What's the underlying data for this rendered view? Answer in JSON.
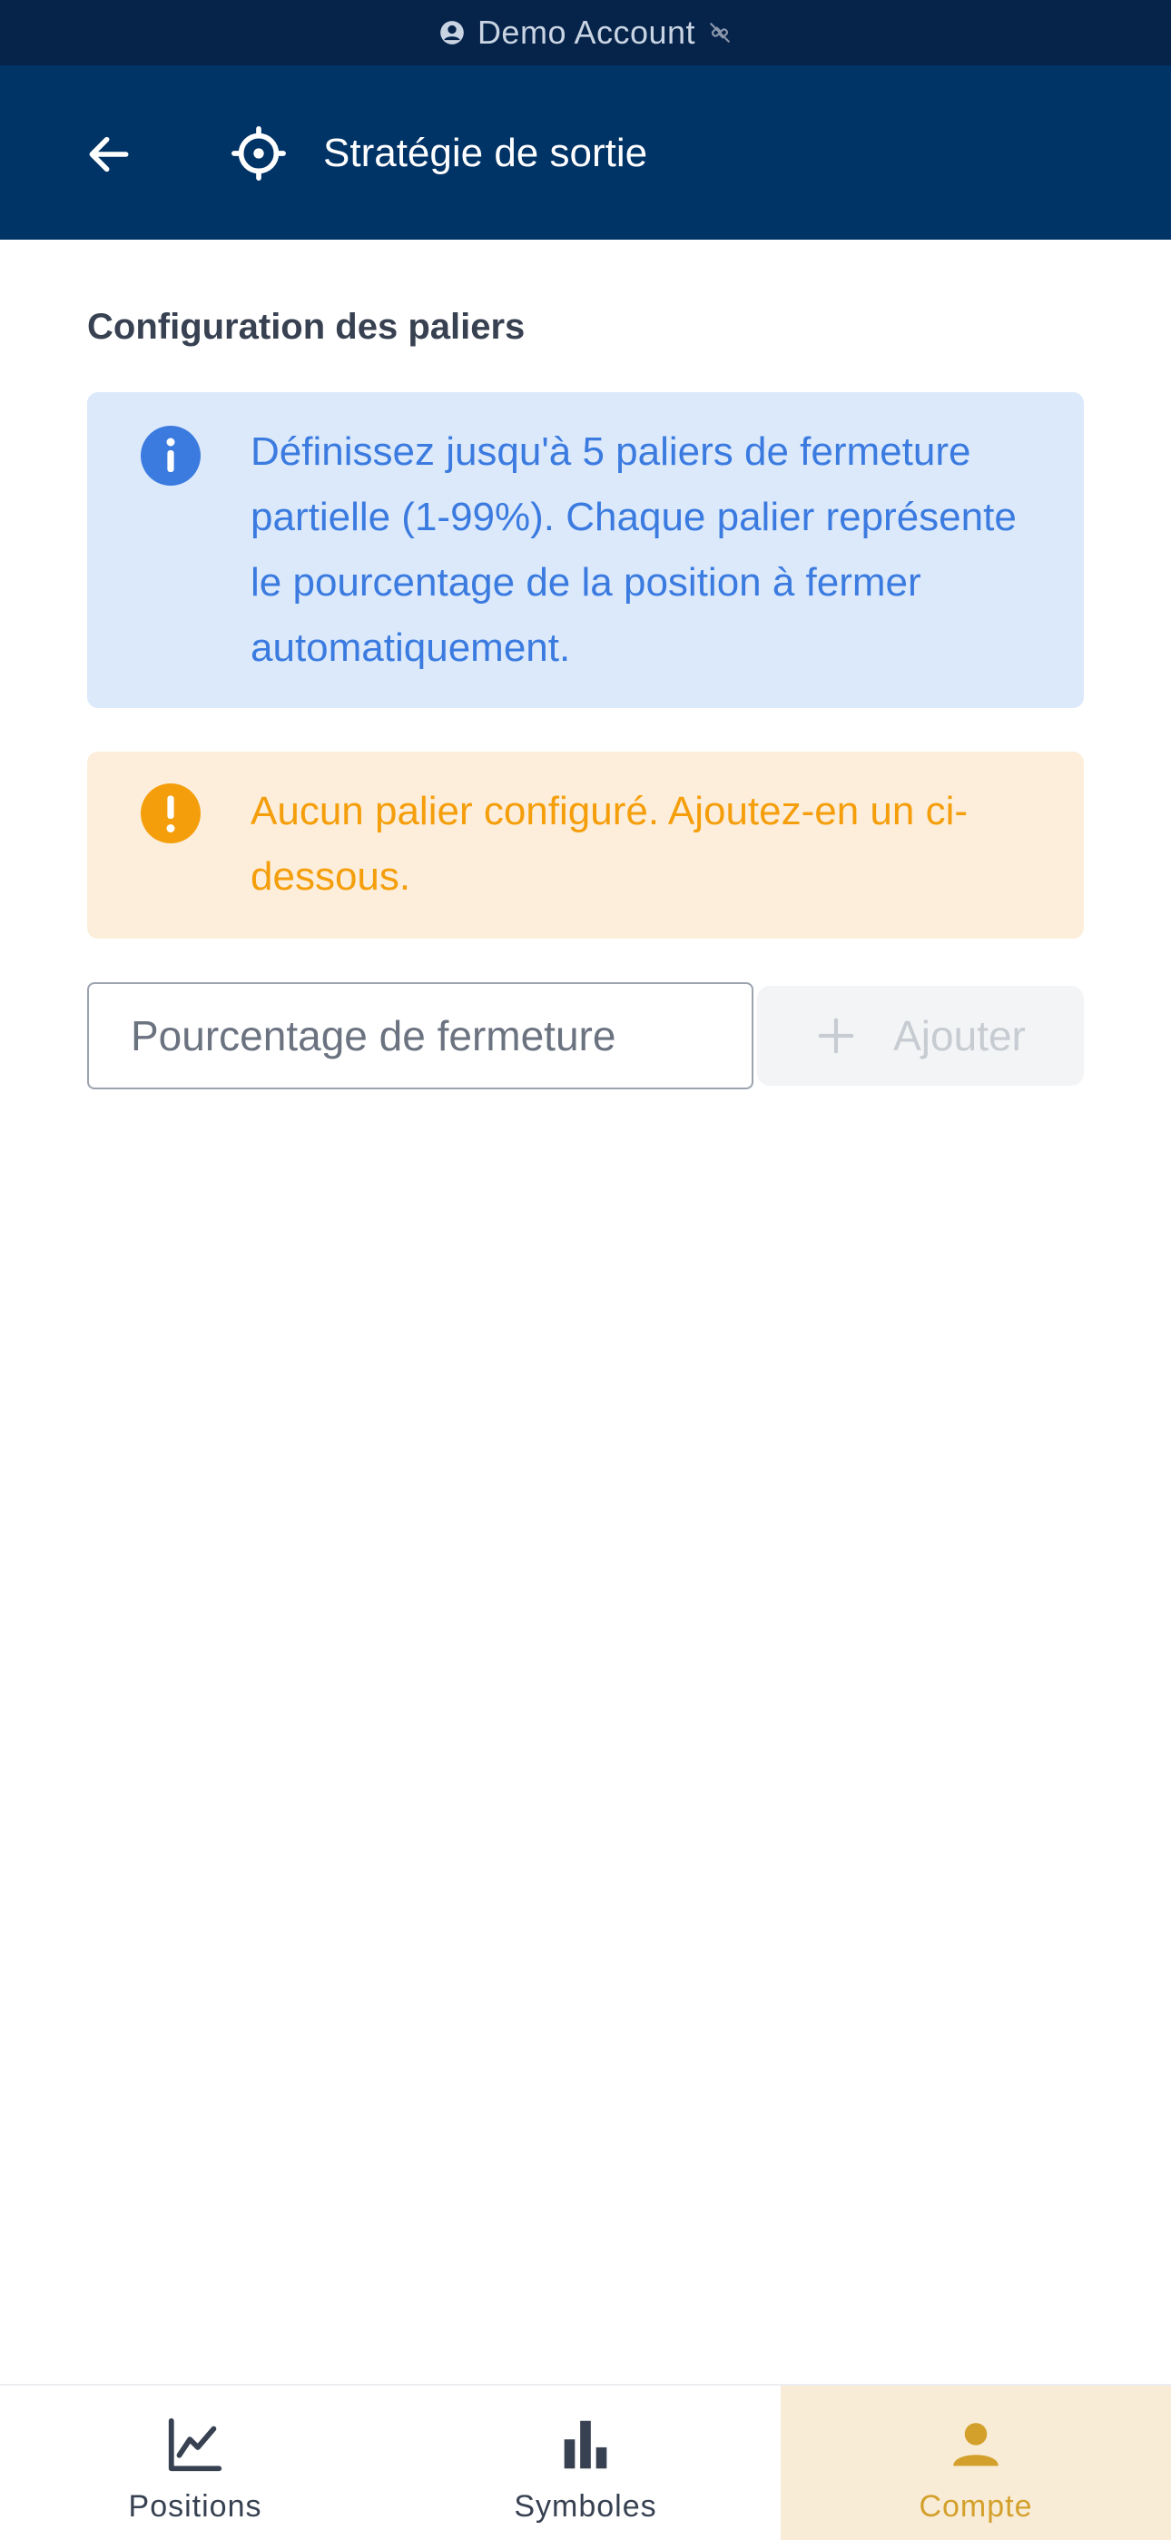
{
  "status_bar": {
    "account_label": "Demo Account",
    "icons": [
      "account-circle-icon",
      "link-off-icon"
    ]
  },
  "app_bar": {
    "title": "Stratégie de sortie",
    "icons": [
      "back-arrow-icon",
      "crosshair-target-icon"
    ]
  },
  "main": {
    "section_title": "Configuration des paliers",
    "info_message": "Définissez jusqu'à 5 paliers de fermeture partielle (1-99%). Chaque palier représente le pourcentage de la position à fermer automatiquement.",
    "warning_message": "Aucun palier configuré. Ajoutez-en un ci-dessous.",
    "percentage_input": {
      "placeholder": "Pourcentage de fermeture",
      "value": ""
    },
    "add_button_label": "Ajouter"
  },
  "bottom_nav": {
    "items": [
      {
        "label": "Positions",
        "icon": "line-chart-icon",
        "active": false
      },
      {
        "label": "Symboles",
        "icon": "bar-chart-icon",
        "active": false
      },
      {
        "label": "Compte",
        "icon": "person-icon",
        "active": true
      }
    ]
  },
  "colors": {
    "status_bar_bg": "#06234a",
    "app_bar_bg": "#003366",
    "info_bg": "#dbe9fb",
    "info_text": "#3b7be0",
    "warning_bg": "#fdeedb",
    "warning_text": "#f59e0b",
    "active_nav_bg": "#f8ecd6",
    "active_nav_text": "#d4a02c"
  }
}
